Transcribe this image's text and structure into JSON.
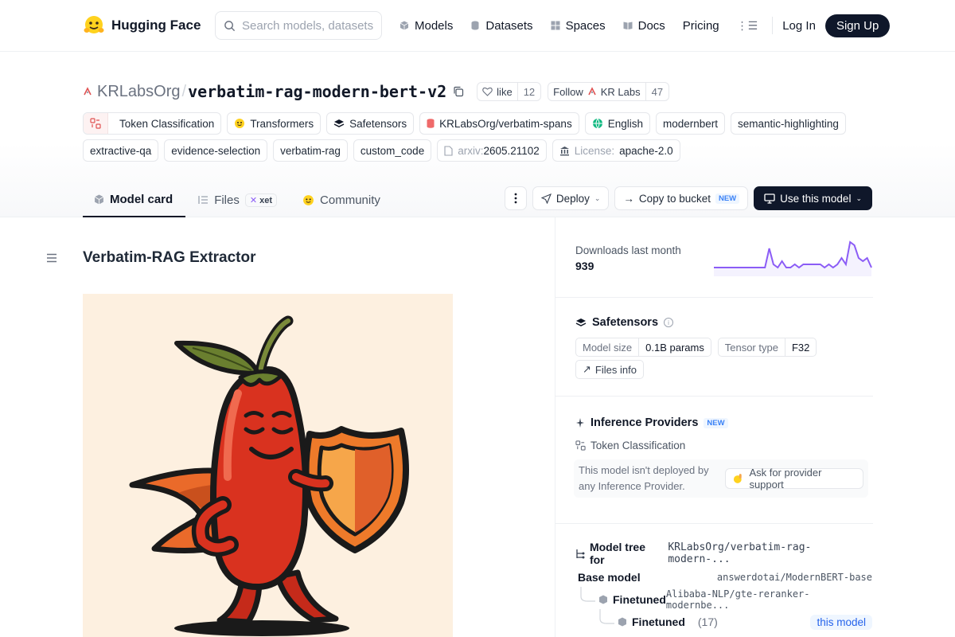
{
  "nav": {
    "brand": "Hugging Face",
    "search_placeholder": "Search models, datasets, users...",
    "links": [
      "Models",
      "Datasets",
      "Spaces",
      "Docs",
      "Pricing"
    ],
    "login": "Log In",
    "signup": "Sign Up"
  },
  "repo": {
    "org": "KRLabsOrg",
    "name": "verbatim-rag-modern-bert-v2",
    "like_label": "like",
    "like_count": "12",
    "follow_label": "Follow",
    "follow_org": "KR Labs",
    "follow_count": "47"
  },
  "tags": {
    "row1": [
      "Token Classification",
      "Transformers",
      "Safetensors",
      "KRLabsOrg/verbatim-spans",
      "English",
      "modernbert",
      "semantic-highlighting"
    ],
    "row2": [
      "extractive-qa",
      "evidence-selection",
      "verbatim-rag",
      "custom_code"
    ],
    "arxiv_key": "arxiv:",
    "arxiv_val": "2605.21102",
    "license_key": "License:",
    "license_val": "apache-2.0"
  },
  "tabs": {
    "model_card": "Model card",
    "files": "Files",
    "xet": "xet",
    "community": "Community"
  },
  "actions": {
    "deploy": "Deploy",
    "copy_bucket": "Copy to bucket",
    "new_badge": "NEW",
    "use_model": "Use this model"
  },
  "card": {
    "title": "Verbatim-RAG Extractor"
  },
  "sidebar": {
    "downloads_label": "Downloads last month",
    "downloads_value": "939",
    "sparkline": [
      2,
      2,
      2,
      2,
      2,
      2,
      2,
      2,
      2,
      2,
      2,
      2,
      2,
      8,
      3,
      2,
      4,
      2,
      2,
      3,
      2,
      3,
      3,
      3,
      3,
      3,
      2,
      3,
      2,
      3,
      5,
      3,
      10,
      9,
      5,
      4,
      5,
      2
    ],
    "accent": "#8b5cf6",
    "safetensors_title": "Safetensors",
    "model_size_key": "Model size",
    "model_size_val": "0.1B params",
    "tensor_type_key": "Tensor type",
    "tensor_type_val": "F32",
    "files_info": "Files info",
    "inference_title": "Inference Providers",
    "inference_new": "NEW",
    "inference_task": "Token Classification",
    "inference_note": "This model isn't deployed by any Inference Provider.",
    "ask_support": "Ask for provider support",
    "tree_title": "Model tree for",
    "tree_repo": "KRLabsOrg/verbatim-rag-modern-...",
    "base_label": "Base model",
    "base_value": "answerdotai/ModernBERT-base",
    "ft1_label": "Finetuned",
    "ft1_value": "Alibaba-NLP/gte-reranker-modernbe...",
    "ft2_label": "Finetuned",
    "ft2_count": "(17)",
    "this_model": "this model"
  }
}
